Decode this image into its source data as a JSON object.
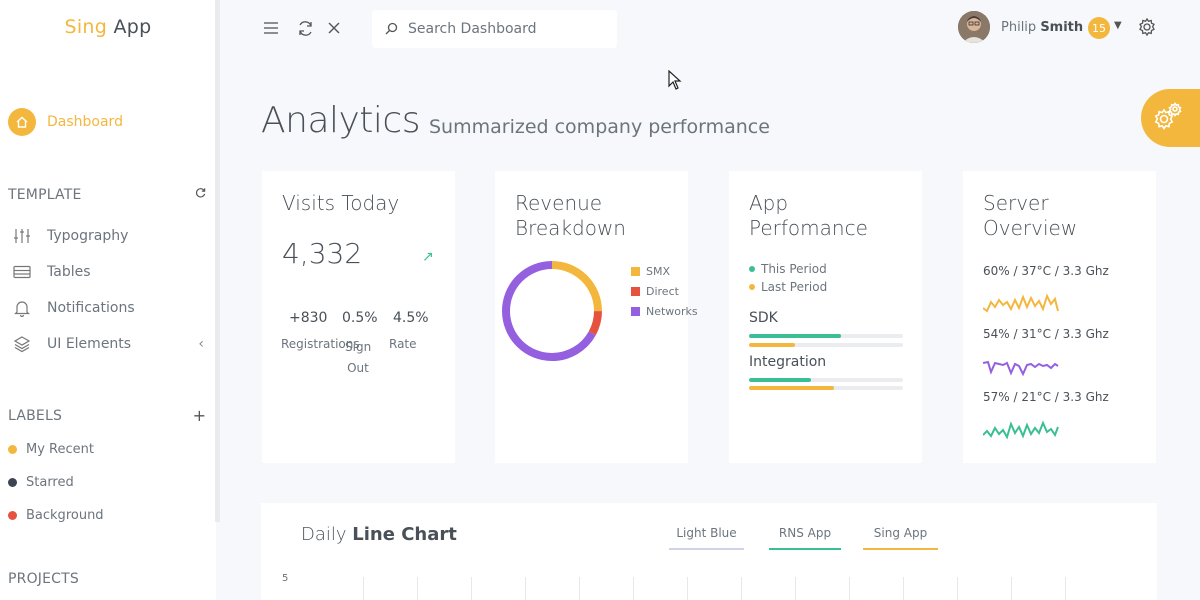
{
  "app": {
    "logo_accent": "Sing",
    "logo_rest": " App"
  },
  "sidebar": {
    "dashboard_label": "Dashboard",
    "template_heading": "TEMPLATE",
    "template_items": [
      {
        "label": "Typography",
        "icon": "sliders-icon"
      },
      {
        "label": "Tables",
        "icon": "table-icon"
      },
      {
        "label": "Notifications",
        "icon": "bell-icon"
      },
      {
        "label": "UI Elements",
        "icon": "layers-icon"
      }
    ],
    "labels_heading": "LABELS",
    "labels_add": "+",
    "labels": [
      {
        "label": "My Recent",
        "color": "#f4b73e"
      },
      {
        "label": "Starred",
        "color": "#3d4552"
      },
      {
        "label": "Background",
        "color": "#e5533f"
      }
    ],
    "projects_heading": "PROJECTS"
  },
  "header": {
    "search_placeholder": "Search Dashboard",
    "user_first": "Philip",
    "user_last": "Smith",
    "notification_count": "15"
  },
  "page": {
    "title": "Analytics",
    "subtitle": "Summarized company performance"
  },
  "visits": {
    "title": "Visits Today",
    "value": "4,332",
    "trend_icon": "↗",
    "stats": [
      {
        "value": "+830",
        "label": "Registrations"
      },
      {
        "value": "0.5%",
        "label": "Sign Out"
      },
      {
        "value": "4.5%",
        "label": "Rate"
      }
    ]
  },
  "revenue": {
    "title_line1": "Revenue",
    "title_line2": "Breakdown",
    "legend": [
      {
        "label": "SMX",
        "color": "#f4b73e"
      },
      {
        "label": "Direct",
        "color": "#e5533f"
      },
      {
        "label": "Networks",
        "color": "#9460e0"
      }
    ],
    "chart_data": {
      "type": "pie",
      "labels": [
        "SMX",
        "Direct",
        "Networks"
      ],
      "values": [
        25,
        8,
        67
      ],
      "colors": [
        "#f4b73e",
        "#e5533f",
        "#9460e0"
      ]
    }
  },
  "app_perf": {
    "title_line1": "App",
    "title_line2": "Perfomance",
    "legend_this": "This Period",
    "legend_last": "Last Period",
    "color_this": "#3abf94",
    "color_last": "#f4b73e",
    "rows": [
      {
        "label": "SDK",
        "this": 0.6,
        "last": 0.3
      },
      {
        "label": "Integration",
        "this": 0.4,
        "last": 0.55
      }
    ]
  },
  "server": {
    "title_line1": "Server",
    "title_line2": "Overview",
    "rows": [
      {
        "label": "60% / 37°C / 3.3 Ghz",
        "color": "#f4b73e"
      },
      {
        "label": "54% / 31°C / 3.3 Ghz",
        "color": "#9460e0"
      },
      {
        "label": "57% / 21°C / 3.3 Ghz",
        "color": "#3abf94"
      }
    ]
  },
  "line_chart": {
    "title_normal": "Daily ",
    "title_bold": "Line Chart",
    "tabs": [
      {
        "label": "Light Blue",
        "color": "#cfd3e8"
      },
      {
        "label": "RNS App",
        "color": "#3abf94"
      },
      {
        "label": "Sing App",
        "color": "#f4b73e"
      }
    ],
    "y_tick": "5"
  }
}
